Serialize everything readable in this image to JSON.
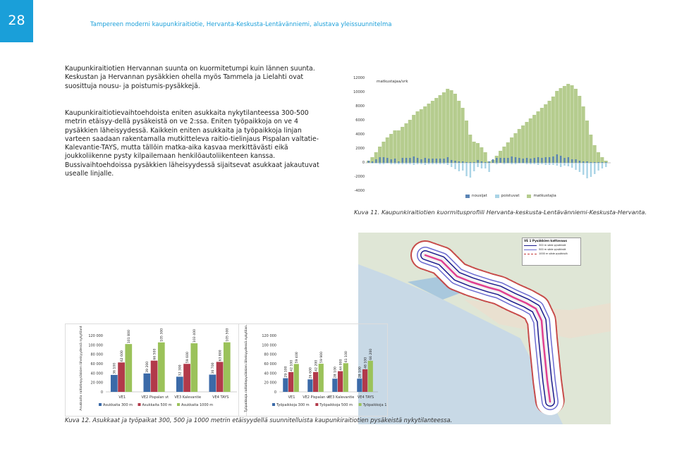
{
  "header": {
    "page_number": "28",
    "title": "Tampereen moderni kaupunkiraitiotie, Hervanta-Keskusta-Lentävänniemi, alustava yleissuunnitelma"
  },
  "body": {
    "p1": "Kaupunkiraitiotien Hervannan suunta on kuormitetumpi kuin lännen suunta. Keskustan ja Hervannan pysäkkien ohella myös Tammela ja Lielahti ovat suosittuja nousu- ja poistumis-pysäkkejä.",
    "p2": "Kaupunkiraitiotievaihtoehdoista eniten asukkaita nykytilanteessa 300-500 metrin etäisyy-dellä pysäkeistä on ve 2:ssa. Eniten työpaikkoja on ve 4 pysäkkien läheisyydessä. Kaikkein eniten asukkaita ja työpaikkoja linjan varteen saadaan rakentamalla mutkitteleva raitio-tielinjaus Pispalan valtatie-Kalevantie-TAYS, mutta tällöin matka-aika kasvaa merkittävästi eikä joukkoliikenne pysty kilpailemaan henkilöautoliikenteen kanssa. Bussivaihtoehdoissa pysäkkien läheisyydessä sijaitsevat asukkaat jakautuvat usealle linjalle."
  },
  "profile_chart": {
    "caption": "Kuva 11. Kaupunkiraitiotien kuormitusprofiili Hervanta-keskusta-Lentävänniemi-Keskusta-Hervanta.",
    "unit_label": "matkustajaa/vrk",
    "y_ticks": [
      "12000",
      "10000",
      "8000",
      "6000",
      "4000",
      "2000",
      "0",
      "-2000",
      "-4000"
    ],
    "legend": [
      "nousijat",
      "poistuvat",
      "matkustajia"
    ],
    "colors": {
      "nousijat": "#5b85b5",
      "poistuvat": "#aad4e6",
      "matkustajia": "#b5cc8e"
    }
  },
  "chart_data": [
    {
      "type": "bar",
      "title": "",
      "xlabel": "",
      "ylabel": "",
      "ylim": [
        -4000,
        12000
      ],
      "series": [
        {
          "name": "matkustajia",
          "values": [
            300,
            800,
            1500,
            2300,
            3000,
            3600,
            4100,
            4600,
            4600,
            5100,
            5600,
            6100,
            6800,
            7300,
            7600,
            8000,
            8400,
            8800,
            9200,
            9600,
            10000,
            10500,
            10300,
            9800,
            8800,
            7800,
            6000,
            4000,
            3000,
            2800,
            2200,
            1500,
            200,
            400,
            1000,
            1700,
            2300,
            2900,
            3600,
            4200,
            4800,
            5300,
            5800,
            6300,
            6800,
            7300,
            7800,
            8300,
            8800,
            9400,
            10200,
            10600,
            10900,
            11200,
            11000,
            10500,
            9500,
            8000,
            6000,
            4000,
            2500,
            1500,
            800,
            300
          ]
        },
        {
          "name": "nousijat",
          "values": [
            300,
            200,
            500,
            800,
            800,
            700,
            500,
            600,
            200,
            700,
            700,
            700,
            900,
            700,
            500,
            700,
            600,
            600,
            600,
            600,
            600,
            800,
            400,
            300,
            200,
            200,
            100,
            100,
            100,
            400,
            200,
            100,
            200,
            500,
            700,
            700,
            700,
            700,
            900,
            800,
            700,
            600,
            700,
            600,
            700,
            800,
            700,
            800,
            800,
            900,
            1200,
            1000,
            700,
            800,
            500,
            500,
            300,
            200,
            200,
            100,
            100,
            100,
            100,
            100
          ]
        },
        {
          "name": "poistuvat",
          "values": [
            0,
            -100,
            -100,
            -200,
            -200,
            -100,
            -200,
            -200,
            -200,
            -200,
            -200,
            -200,
            -300,
            -200,
            -200,
            -300,
            -200,
            -200,
            -200,
            -200,
            -200,
            -300,
            -600,
            -900,
            -1200,
            -1100,
            -1900,
            -2100,
            -1200,
            -600,
            -800,
            -800,
            -1300,
            0,
            -200,
            0,
            -200,
            -100,
            -200,
            -200,
            -100,
            -100,
            -200,
            -200,
            -200,
            -300,
            -200,
            -300,
            -300,
            -300,
            -400,
            -600,
            -400,
            -500,
            -700,
            -1000,
            -1300,
            -1700,
            -2200,
            -2000,
            -1600,
            -1100,
            -800,
            -600
          ]
        }
      ]
    },
    {
      "type": "bar",
      "title": "",
      "ylabel": "Asukkaita raitiotiepysäkkien läheisyydessä nykytilanteessa",
      "categories": [
        "VE1",
        "VE2 Pispalan vt",
        "VE3 Kalevantie",
        "VE4 TAYS"
      ],
      "ylim": [
        0,
        120000
      ],
      "y_ticks": [
        "120 000",
        "100 000",
        "80 000",
        "60 000",
        "40 000",
        "20 000",
        "0"
      ],
      "series": [
        {
          "name": "Asukkaita 300 m",
          "values": [
            36100,
            39200,
            32300,
            36700
          ],
          "labels": [
            "36 100",
            "39 200",
            "32 300",
            "36 700"
          ]
        },
        {
          "name": "Asukkaita 500 m",
          "values": [
            62600,
            66500,
            59600,
            63800
          ],
          "labels": [
            "62 600",
            "66 500",
            "59 600",
            "63 800"
          ]
        },
        {
          "name": "Asukkaita 1000 m",
          "values": [
            101800,
            105300,
            103400,
            105500
          ],
          "labels": [
            "101 800",
            "105 300",
            "103 400",
            "105 500"
          ]
        }
      ]
    },
    {
      "type": "bar",
      "title": "",
      "ylabel": "Työpaikkoja raitiotiepysäkkien läheisyydessä nykytilanteessa",
      "categories": [
        "VE1",
        "VE2 Pispalan vt",
        "VE3 Kalevantie",
        "VE4 TAYS"
      ],
      "ylim": [
        0,
        120000
      ],
      "y_ticks": [
        "120 000",
        "100 000",
        "80 000",
        "60 000",
        "40 000",
        "20 000",
        "0"
      ],
      "series": [
        {
          "name": "Työpaikkoja 300 m",
          "values": [
            29100,
            26600,
            28100,
            28100
          ],
          "labels": [
            "29 100",
            "26 600",
            "28 100",
            "28 100"
          ]
        },
        {
          "name": "Työpaikkoja 500 m",
          "values": [
            42100,
            42200,
            44000,
            48100
          ],
          "labels": [
            "42 100",
            "42 200",
            "44 000",
            "48 100"
          ]
        },
        {
          "name": "Työpaikkoja 1000 m",
          "values": [
            59400,
            59900,
            61100,
            66200
          ],
          "labels": [
            "59 400",
            "59 900",
            "61 100",
            "66 200"
          ]
        }
      ]
    }
  ],
  "bar_colors": [
    "#3b6aa8",
    "#b23a4a",
    "#9bc25a"
  ],
  "map": {
    "legend_title": "VE 1 Pysäkkien kattavuus",
    "legend_items": [
      "300 m säde pysäkistä",
      "500 m säde pysäkistä",
      "1000 m säde pysäkistä"
    ],
    "line_colors": [
      "#1b1b8c",
      "#6b6bd0",
      "#c43a3a"
    ]
  },
  "caption2": "Kuva 12. Asukkaat ja työpaikat 300, 500 ja 1000 metrin etäisyydellä suunnitelluista kaupunkiraitiotien pysäkeistä nykytilanteessa."
}
